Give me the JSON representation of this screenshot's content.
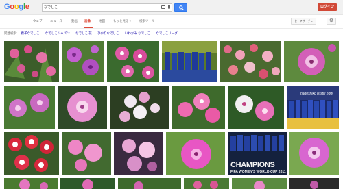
{
  "header": {
    "logo_letters": [
      {
        "ch": "G",
        "color": "#4285f4"
      },
      {
        "ch": "o",
        "color": "#ea4335"
      },
      {
        "ch": "o",
        "color": "#fbbc05"
      },
      {
        "ch": "g",
        "color": "#4285f4"
      },
      {
        "ch": "l",
        "color": "#34a853"
      },
      {
        "ch": "e",
        "color": "#ea4335"
      }
    ],
    "search_value": "なでしこ",
    "login_label": "ログイン"
  },
  "tabs": {
    "items": [
      "ウェブ",
      "ニュース",
      "動画",
      "画像",
      "地図",
      "もっと見る ▾",
      "検索ツール"
    ],
    "active_index": 3,
    "safesearch_label": "セーフサーチ ▾",
    "settings_icon": "gear-icon"
  },
  "related": {
    "label": "関連検索:",
    "items": [
      "撫子なでしこ",
      "なでしこジャパン",
      "なでしこ 花",
      "ひかりなでしこ",
      "いわかみ なでしこ",
      "なでしこリーグ"
    ]
  },
  "images": {
    "champions_title": "CHAMPIONS",
    "champions_sub": "FIFA WOMEN'S WORLD CUP 2011",
    "nadeshiko_caption": "nadeshiko is still now"
  },
  "colors": {
    "accent_red": "#dd4b39",
    "search_blue": "#4285f4",
    "login_red": "#d14836",
    "link_blue": "#1a0dab"
  }
}
